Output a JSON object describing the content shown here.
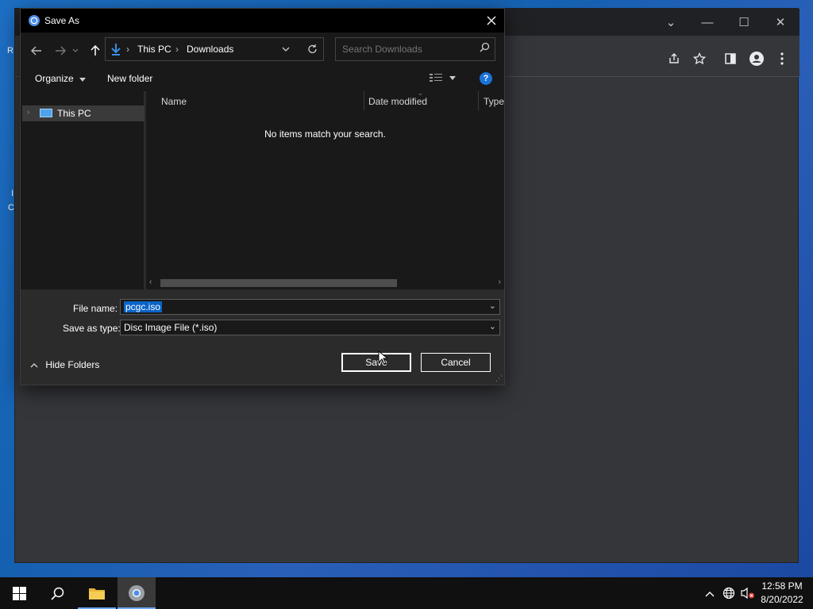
{
  "desktop": {
    "left_fragments": [
      "R",
      "I",
      "C"
    ]
  },
  "browser": {
    "window_controls": {
      "dropdown": "⌄",
      "minimize": "—",
      "maximize": "☐",
      "close": "✕"
    }
  },
  "dialog": {
    "title": "Save As",
    "address": {
      "crumbs": [
        "This PC",
        "Downloads"
      ]
    },
    "search": {
      "placeholder": "Search Downloads"
    },
    "commands": {
      "organize": "Organize",
      "new_folder": "New folder",
      "help": "?"
    },
    "tree": {
      "items": [
        {
          "label": "This PC"
        }
      ]
    },
    "columns": [
      "Name",
      "Date modified",
      "Type"
    ],
    "empty_message": "No items match your search.",
    "file_name": {
      "label": "File name:",
      "value": "pcgc.iso"
    },
    "save_as_type": {
      "label": "Save as type:",
      "value": "Disc Image File (*.iso)"
    },
    "hide_folders": "Hide Folders",
    "save_button": "Save",
    "cancel_button": "Cancel"
  },
  "taskbar": {
    "time": "12:58 PM",
    "date": "8/20/2022"
  },
  "colors": {
    "accent": "#0a64c8",
    "dialog_bg": "#2b2b2b",
    "dark_bg": "#191919",
    "taskbar_bg": "#101010"
  },
  "icons": [
    "windows-start-icon",
    "search-icon",
    "file-explorer-icon",
    "chrome-icon",
    "tray-chevron-icon",
    "network-globe-icon",
    "volume-muted-icon"
  ]
}
